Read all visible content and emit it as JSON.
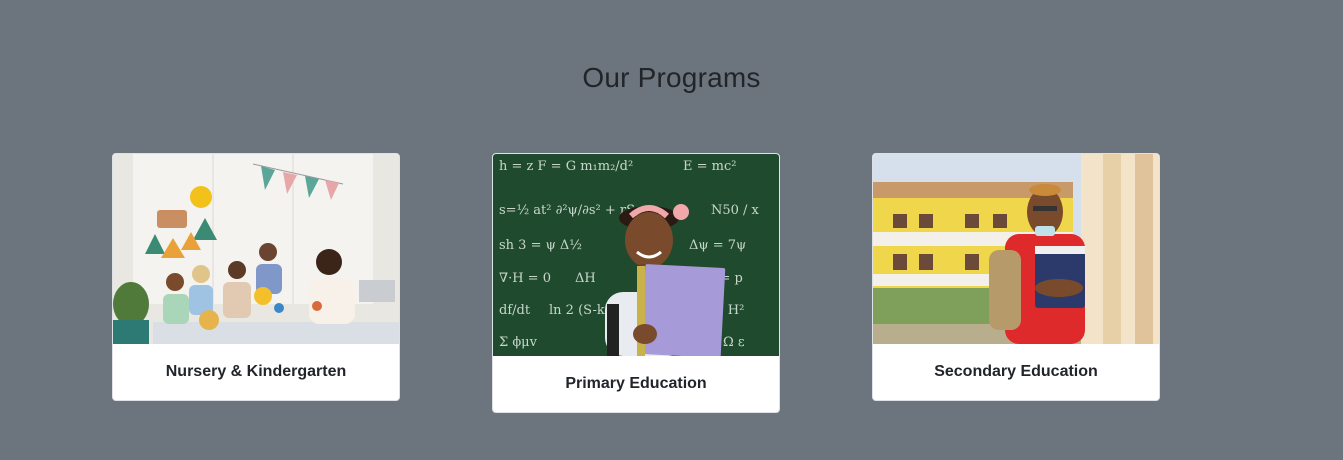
{
  "section": {
    "title": "Our Programs"
  },
  "programs": [
    {
      "label": "Nursery & Kindergarten",
      "image": "classroom-children-photo"
    },
    {
      "label": "Primary Education",
      "image": "girl-chalkboard-photo",
      "chalk": [
        "E = mc²",
        "ΔH",
        "N50 / x",
        "∇·H = 0",
        "df/dt"
      ]
    },
    {
      "label": "Secondary Education",
      "image": "student-campus-photo"
    }
  ],
  "colors": {
    "background": "#6c757d",
    "card": "#ffffff",
    "text": "#212529"
  }
}
